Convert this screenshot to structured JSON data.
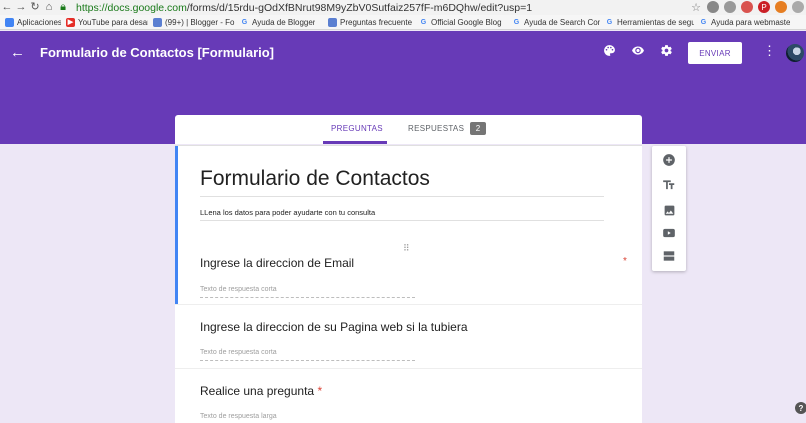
{
  "browser": {
    "url_host": "https://docs.google.com",
    "url_path": "/forms/d/15rdu-gOdXfBNrut98M9yZbV0Sutfaiz257fF-m6DQhw/edit?usp=1",
    "bookmarks": [
      {
        "label": "Aplicaciones",
        "icon": "apps-grid-icon",
        "color": "#4285f4"
      },
      {
        "label": "YouTube para desarr",
        "icon": "youtube-icon",
        "color": "#e52d27"
      },
      {
        "label": "(99+) | Blogger - Foro",
        "icon": "blogger-icon",
        "color": "#5b7fd1"
      },
      {
        "label": "Ayuda de Blogger",
        "icon": "google-icon",
        "color": "#4285f4"
      },
      {
        "label": "Preguntas frecuente",
        "icon": "blogger-icon",
        "color": "#5b7fd1"
      },
      {
        "label": "Official Google Blog",
        "icon": "google-icon",
        "color": "#4285f4"
      },
      {
        "label": "Ayuda de Search Con",
        "icon": "google-icon",
        "color": "#4285f4"
      },
      {
        "label": "Herramientas de segu",
        "icon": "google-icon",
        "color": "#4285f4"
      },
      {
        "label": "Ayuda para webmaste",
        "icon": "google-icon",
        "color": "#4285f4"
      }
    ]
  },
  "header": {
    "title": "Formulario de Contactos [Formulario]",
    "send_label": "ENVIAR",
    "accent_color": "#673ab7"
  },
  "tabs": {
    "preguntas": "PREGUNTAS",
    "respuestas": "RESPUESTAS",
    "respuestas_count": "2"
  },
  "form": {
    "title": "Formulario de Contactos",
    "description": "LLena los datos para poder ayudarte con tu consulta",
    "questions": [
      {
        "label": "Ingrese la direccion de Email",
        "hint": "Texto de respuesta corta",
        "required": true
      },
      {
        "label": "Ingrese la direccion de su Pagina web si la tubiera",
        "hint": "Texto de respuesta corta",
        "required": false
      },
      {
        "label": "Realice una pregunta",
        "hint": "Texto de respuesta larga",
        "required": true
      }
    ],
    "required_mark": "*"
  }
}
